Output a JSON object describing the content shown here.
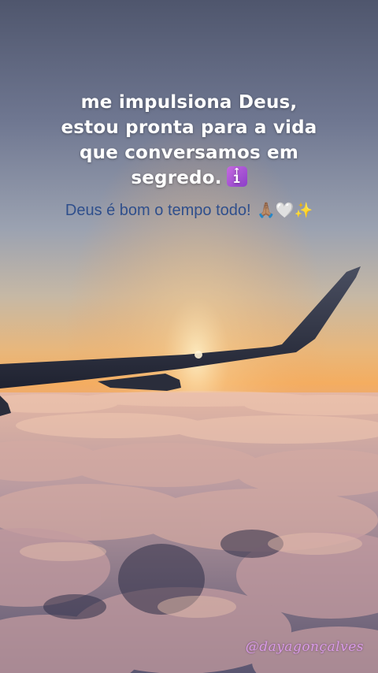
{
  "caption": {
    "lines": [
      "me impulsiona Deus,",
      "estou pronta para a vida",
      "que conversamos em",
      "segredo."
    ],
    "emoji": "up-arrow-number-1-icon"
  },
  "subtitle": {
    "text": "Deus é bom o tempo todo!",
    "emoji": "🙏🏽🤍✨"
  },
  "watermark": {
    "text": "@dayagonçalves"
  },
  "colors": {
    "caption": "#ffffff",
    "subtitle": "#2f4f8c",
    "watermark": "#d99ce6",
    "sky_top": "#57607a",
    "sky_horizon": "#f0b064",
    "clouds": "#c7a3a3"
  }
}
